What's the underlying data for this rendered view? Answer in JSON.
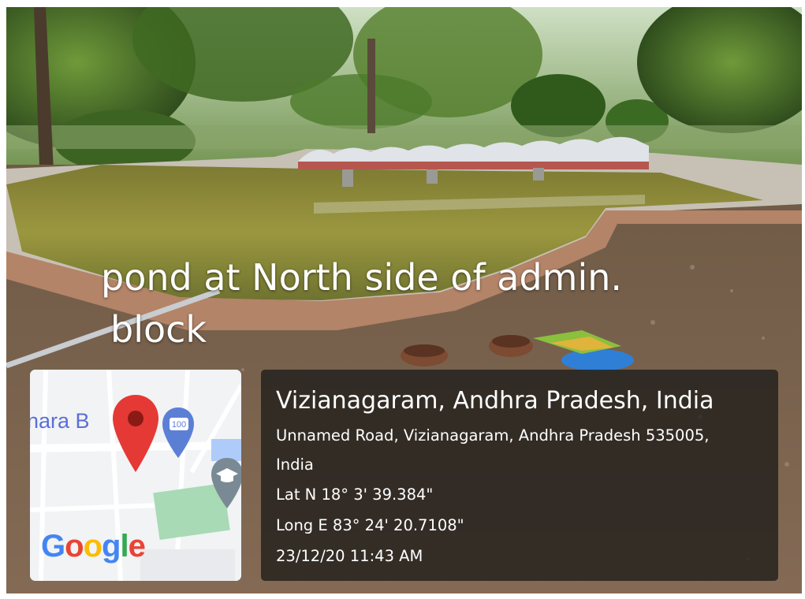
{
  "caption": {
    "line1": "pond at North side of admin.",
    "line2": "block"
  },
  "map": {
    "place_label": "nara B",
    "road_shield_icon": "100",
    "logo": [
      "G",
      "o",
      "o",
      "g",
      "l",
      "e"
    ],
    "logo_colors": [
      "#4285F4",
      "#EA4335",
      "#FBBC05",
      "#4285F4",
      "#34A853",
      "#EA4335"
    ],
    "pin_color": "#E53935",
    "pin_icon": "map-pin-icon",
    "poi_icons": [
      "fuel-station-icon",
      "graduation-cap-icon"
    ]
  },
  "location": {
    "title": "Vizianagaram, Andhra Pradesh, India",
    "address_line1": "Unnamed Road, Vizianagaram, Andhra Pradesh 535005,",
    "address_line2": "India",
    "latitude": "Lat N 18° 3' 39.384\"",
    "longitude": "Long E 83° 24' 20.7108\"",
    "datetime": "23/12/20 11:43 AM"
  },
  "scene": {
    "description_colors": {
      "foliage": "#4f7a2e",
      "water": "#8c8a3c",
      "ground": "#7a6450",
      "bridge_rail": "#d9dde3",
      "bridge_deck": "#b5574f"
    }
  }
}
